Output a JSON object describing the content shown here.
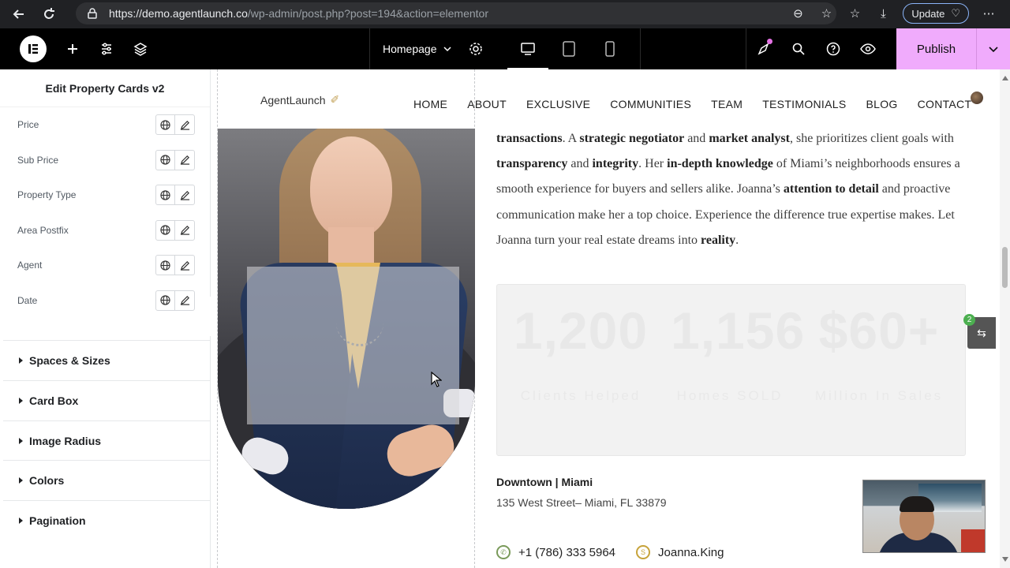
{
  "browser": {
    "url_host": "https://demo.agentlaunch.co",
    "url_path": "/wp-admin/post.php?post=194&action=elementor",
    "update_label": "Update"
  },
  "editor": {
    "page_name": "Homepage",
    "publish_label": "Publish"
  },
  "panel": {
    "title": "Edit Property Cards v2",
    "dynamic_fields": [
      {
        "label": "Price"
      },
      {
        "label": "Sub Price"
      },
      {
        "label": "Property Type"
      },
      {
        "label": "Area Postfix"
      },
      {
        "label": "Agent"
      },
      {
        "label": "Date"
      }
    ],
    "sections": [
      {
        "label": "Spaces & Sizes"
      },
      {
        "label": "Card Box"
      },
      {
        "label": "Image Radius"
      },
      {
        "label": "Colors"
      },
      {
        "label": "Pagination"
      }
    ]
  },
  "site": {
    "logo": "AgentLaunch",
    "nav": [
      "HOME",
      "ABOUT",
      "EXCLUSIVE",
      "COMMUNITIES",
      "TEAM",
      "TESTIMONIALS",
      "BLOG",
      "CONTACT"
    ],
    "bio": {
      "p1": "transactions",
      "p2": ". A ",
      "p3": "strategic negotiator",
      "p4": " and ",
      "p5": "market analyst",
      "p6": ", she prioritizes client goals with ",
      "p7": "transparency",
      "p8": " and ",
      "p9": "integrity",
      "p10": ". Her ",
      "p11": "in-depth knowledge",
      "p12": " of Miami’s neighborhoods ensures a smooth experience for buyers and sellers alike. Joanna’s ",
      "p13": "attention to detail",
      "p14": " and proactive communication make her a top choice. Experience the difference true expertise makes. Let Joanna turn your real estate dreams into ",
      "p15": "reality",
      "p16": "."
    },
    "stats": [
      {
        "number": "1,200",
        "label": "Clients Helped"
      },
      {
        "number": "1,156",
        "label": "Homes SOLD"
      },
      {
        "number": "$60+",
        "label": "Million In Sales"
      }
    ],
    "location": "Downtown | Miami",
    "address": "135 West Street– Miami, FL 33879",
    "phone": "+1 (786) 333 5964",
    "skype": "Joanna.King"
  },
  "widget": {
    "badge": "2"
  },
  "colors": {
    "publish": "#f0abfc",
    "chrome": "#202124",
    "editor_bar": "#000000"
  }
}
